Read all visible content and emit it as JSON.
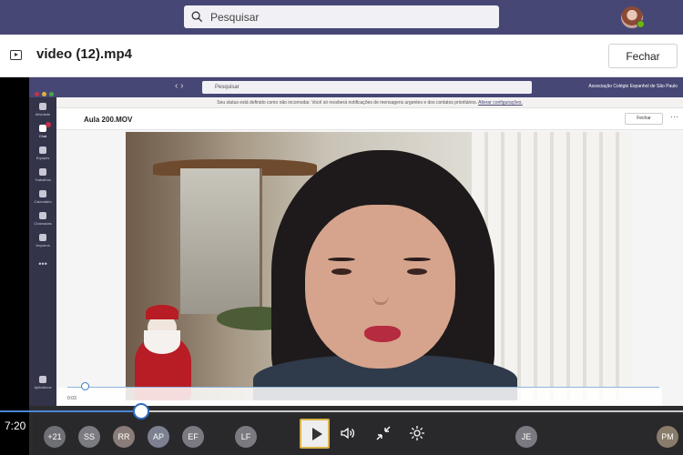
{
  "search": {
    "placeholder": "Pesquisar"
  },
  "header": {
    "file_title": "video (12).mp4",
    "close_label": "Fechar"
  },
  "inner": {
    "search_placeholder": "Pesquisar",
    "org_name": "Associação Colégio Espanhol de São Paulo",
    "notice_text": "Seu status está definido como não incomodar. Você só receberá notificações de mensagens urgentes e dos contatos prioritários.",
    "notice_link": "Alterar configurações.",
    "file_title": "Aula 200.MOV",
    "close_label": "Fechar",
    "time": "0:03",
    "rail": [
      {
        "label": "Atividade"
      },
      {
        "label": "Chat"
      },
      {
        "label": "Equipes"
      },
      {
        "label": "Trabalhos"
      },
      {
        "label": "Calendário"
      },
      {
        "label": "Chamadas"
      },
      {
        "label": "Arquivos"
      },
      {
        "label": "Aplicativos"
      },
      {
        "label": "Ajuda"
      }
    ]
  },
  "player": {
    "current_time": "7:20",
    "progress_fraction": 0.207
  },
  "participants": [
    {
      "initials": "+21",
      "color": "#6f6f76"
    },
    {
      "initials": "SS",
      "color": "#7b7b82"
    },
    {
      "initials": "RR",
      "color": "#8a7c78"
    },
    {
      "initials": "AP",
      "color": "#7c8090"
    },
    {
      "initials": "EF",
      "color": "#7a7a80"
    },
    {
      "initials": "LF",
      "color": "#7a7a80"
    },
    {
      "initials": "JE",
      "color": "#7a7a80"
    },
    {
      "initials": "PM",
      "color": "#8a7c6a"
    }
  ]
}
